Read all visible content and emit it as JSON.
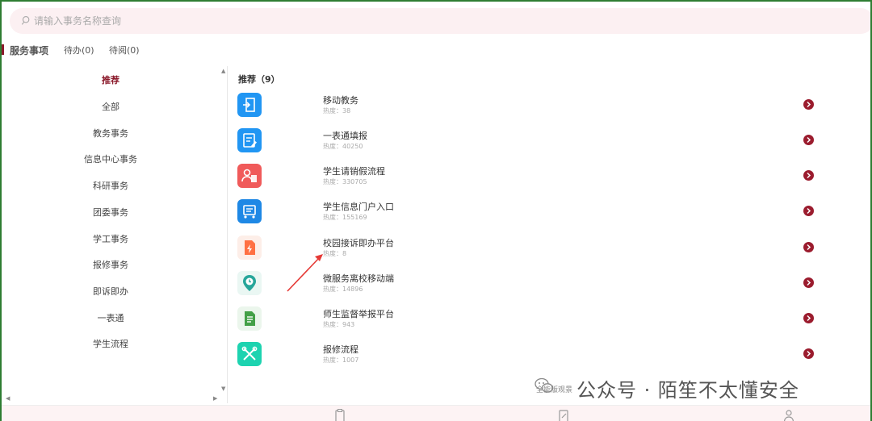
{
  "search": {
    "placeholder": "请输入事务名称查询"
  },
  "tabs": {
    "main": "服务事项",
    "todo": "待办(0)",
    "read": "待阅(0)"
  },
  "sidebar": {
    "items": [
      "推荐",
      "全部",
      "教务事务",
      "信息中心事务",
      "科研事务",
      "团委事务",
      "学工事务",
      "报修事务",
      "即诉即办",
      "一表通",
      "学生流程"
    ],
    "active": "推荐"
  },
  "section": {
    "title": "推荐（9）"
  },
  "services": [
    {
      "name": "移动教务",
      "heat": "热度：38",
      "color": "#2196f3",
      "icon": "exit-door-icon"
    },
    {
      "name": "一表通填报",
      "heat": "热度：40250",
      "color": "#2196f3",
      "icon": "edit-form-icon"
    },
    {
      "name": "学生请销假流程",
      "heat": "热度：330705",
      "color": "#f05a5a",
      "icon": "person-document-icon"
    },
    {
      "name": "学生信息门户入口",
      "heat": "热度：155169",
      "color": "#1e88e5",
      "icon": "portal-icon"
    },
    {
      "name": "校园接诉即办平台",
      "heat": "热度：8",
      "color": "#ff7043",
      "icon": "lightning-document-icon"
    },
    {
      "name": "微服务离校移动端",
      "heat": "热度：14896",
      "color": "#26a69a",
      "icon": "location-clock-icon"
    },
    {
      "name": "师生监督举报平台",
      "heat": "热度：943",
      "color": "#43a047",
      "icon": "report-document-icon"
    },
    {
      "name": "报修流程",
      "heat": "热度：1007",
      "color": "#1dd3b0",
      "icon": "tools-icon"
    }
  ],
  "watermark": {
    "small": "全能版观景",
    "text": "公众号 · 陌笙不太懂安全"
  },
  "colors": {
    "accent": "#8b1a2b",
    "frame": "#2e7d32",
    "search_bg": "#fcf0f2"
  }
}
